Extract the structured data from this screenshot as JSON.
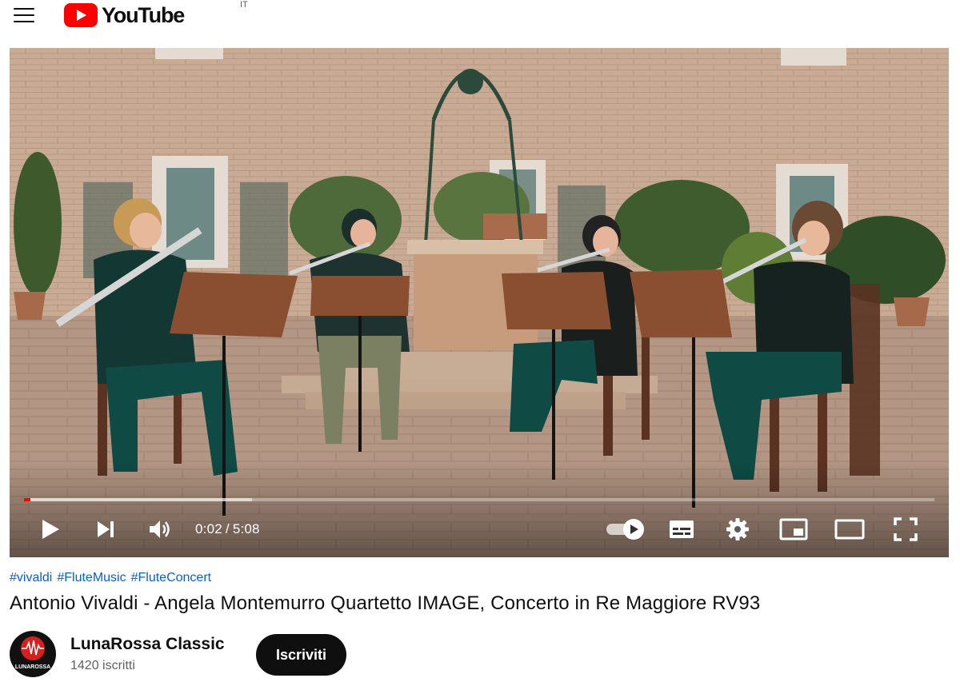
{
  "header": {
    "logo_text": "YouTube",
    "region": "IT"
  },
  "player": {
    "current_time": "0:02",
    "separator": "/",
    "duration": "5:08",
    "played_fraction": 0.0065,
    "buffered_fraction": 0.25,
    "autoplay_on": true
  },
  "video": {
    "hashtags": [
      "#vivaldi",
      "#FluteMusic",
      "#FluteConcert"
    ],
    "title": "Antonio Vivaldi - Angela Montemurro Quartetto IMAGE, Concerto in Re Maggiore RV93"
  },
  "channel": {
    "name": "LunaRossa Classic",
    "subscribers": "1420 iscritti",
    "avatar_text": "LUNAROSSA",
    "subscribe_label": "Iscriviti"
  },
  "colors": {
    "brand_red": "#ff0000",
    "link": "#065fd4",
    "button_dark": "#0f0f0f"
  }
}
